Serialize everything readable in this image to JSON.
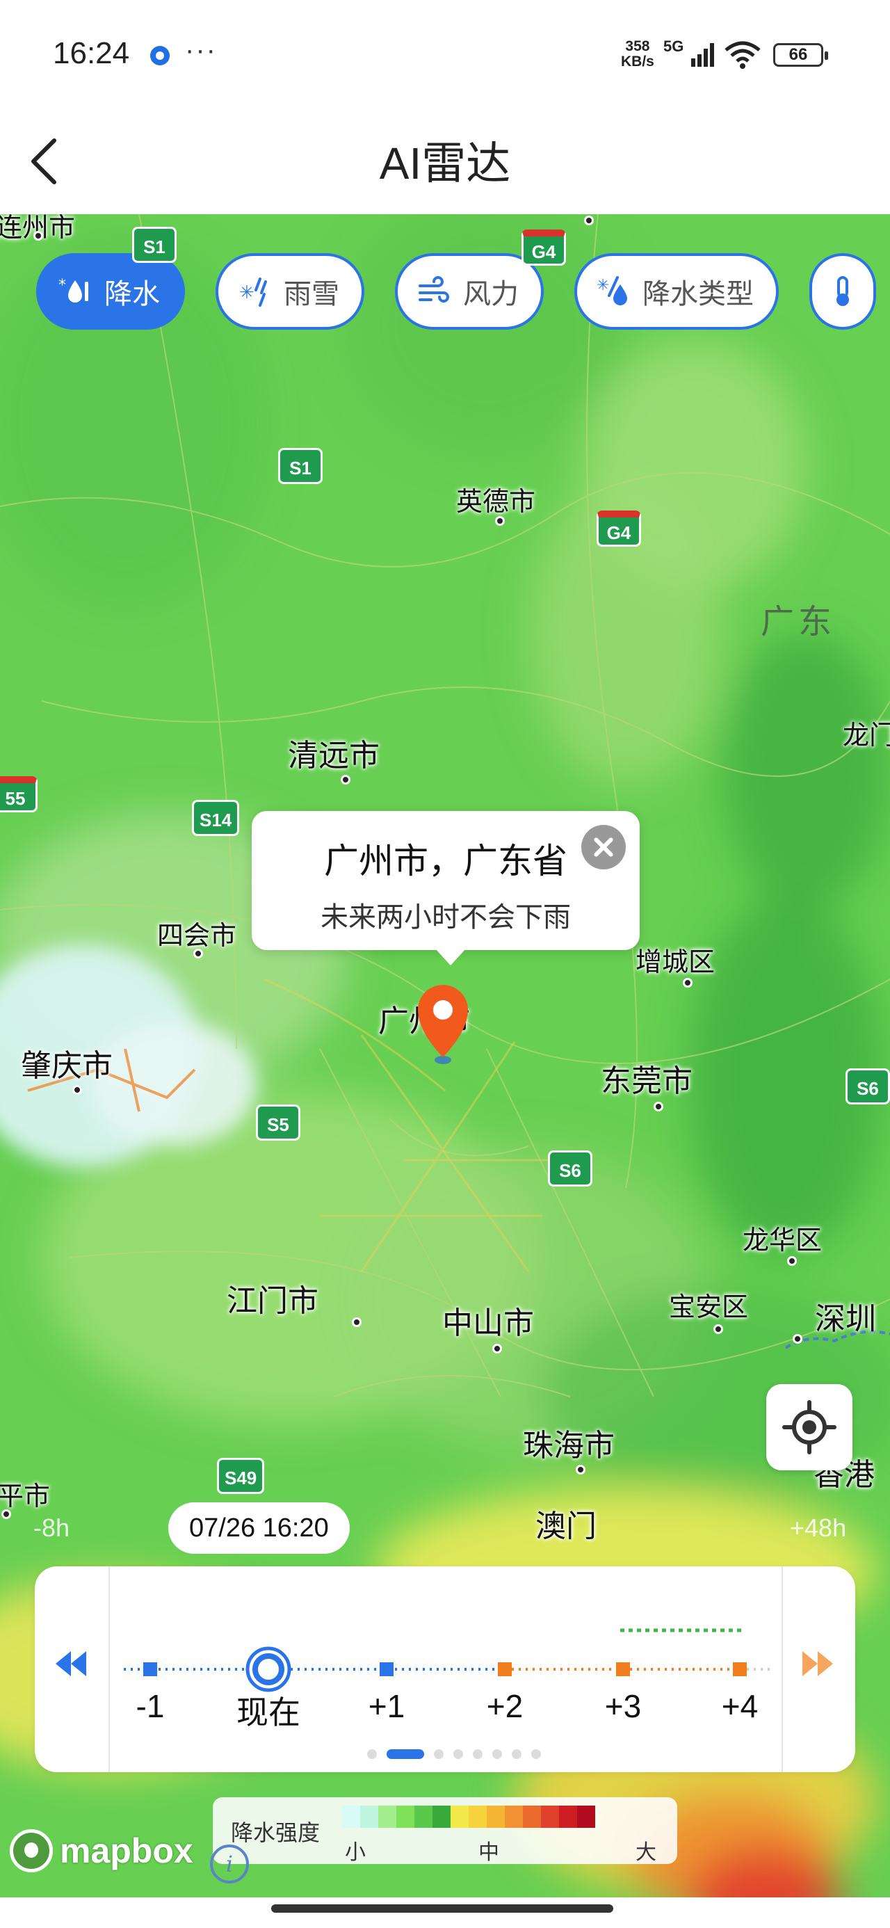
{
  "status_bar": {
    "time": "16:24",
    "more": "···",
    "net_speed_value": "358",
    "net_speed_unit": "KB/s",
    "network": "5G",
    "battery": "66"
  },
  "header": {
    "title": "AI雷达"
  },
  "layers": [
    {
      "label": "降水",
      "icon": "precipitation-icon",
      "active": true
    },
    {
      "label": "雨雪",
      "icon": "rain-snow-icon",
      "active": false
    },
    {
      "label": "风力",
      "icon": "wind-icon",
      "active": false
    },
    {
      "label": "降水类型",
      "icon": "precip-type-icon",
      "active": false
    }
  ],
  "map": {
    "cities": {
      "yingde": "英德市",
      "qingyuan": "清远市",
      "sihui": "四会市",
      "zhaoqing": "肇庆市",
      "guangzhou": "广州市",
      "zengcheng": "增城区",
      "dongguan": "东莞市",
      "longhua": "龙华区",
      "jiangmen": "江门市",
      "zhongshan": "中山市",
      "baoan": "宝安区",
      "shenzhen": "深圳",
      "zhuhai": "珠海市",
      "macau": "澳门",
      "hongkong": "香港",
      "longmen": "龙门",
      "left_top": "连州市",
      "left_bottom": "平市"
    },
    "province": "广东",
    "shields": {
      "s1_top": "S1",
      "g4_top": "G4",
      "s1": "S1",
      "g4": "G4",
      "s55": "55",
      "s14": "S14",
      "s5": "S5",
      "s6_a": "S6",
      "s6_b": "S6",
      "s49": "S49"
    }
  },
  "popup": {
    "location": "广州市，广东省",
    "forecast": "未来两小时不会下雨"
  },
  "timeline": {
    "current_time": "07/26 16:20",
    "range_start": "-8h",
    "range_end": "+48h",
    "labels": [
      "-1",
      "现在",
      "+1",
      "+2",
      "+3",
      "+4"
    ],
    "selected_index": 1,
    "pages": 8,
    "active_page": 1
  },
  "legend": {
    "title": "降水强度",
    "low": "小",
    "mid": "中",
    "high": "大",
    "colors": [
      "#d7fbf5",
      "#bff5df",
      "#a3ee8d",
      "#7fe05a",
      "#58c94a",
      "#38aa3c",
      "#f2e94a",
      "#f6d23d",
      "#f4b534",
      "#f19232",
      "#ea6a2e",
      "#e0412c",
      "#cd1e24",
      "#b20a1e"
    ]
  },
  "attribution": {
    "brand": "mapbox",
    "info": "i"
  },
  "colors": {
    "accent": "#2a74e8",
    "pin": "#f25a1d",
    "future": "#f07d1e"
  }
}
